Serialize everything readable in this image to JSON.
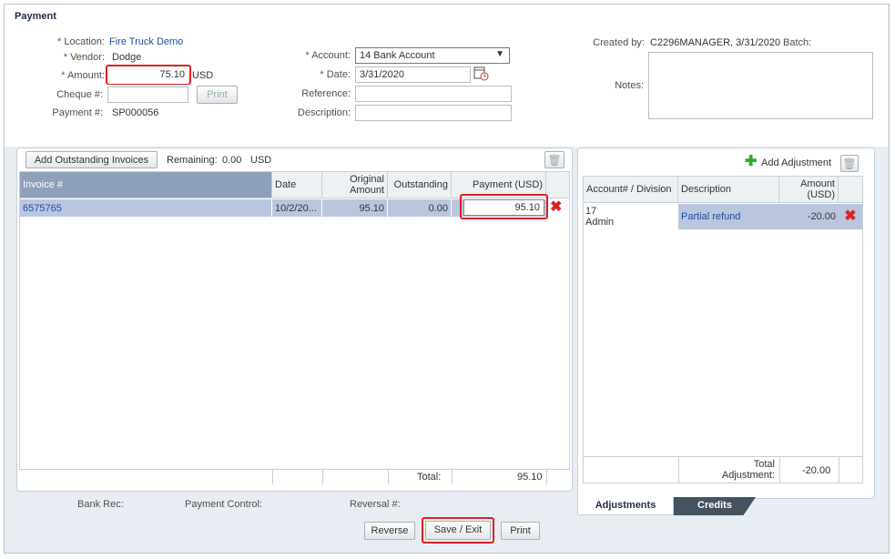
{
  "page": {
    "title": "Payment"
  },
  "form": {
    "location_label": "Location:",
    "location_value": "Fire Truck Demo",
    "vendor_label": "Vendor:",
    "vendor_value": "Dodge",
    "amount_label": "Amount:",
    "amount_value": "75.10",
    "amount_currency": "USD",
    "cheque_label": "Cheque #:",
    "cheque_value": "",
    "print_label": "Print",
    "payment_no_label": "Payment #:",
    "payment_no_value": "SP000056",
    "account_label": "Account:",
    "account_value": "14 Bank Account",
    "date_label": "Date:",
    "date_value": "3/31/2020",
    "reference_label": "Reference:",
    "reference_value": "",
    "description_label": "Description:",
    "description_value": "",
    "created_by_label": "Created by:",
    "created_by_value": "C2296MANAGER, 3/31/2020",
    "batch_label": "Batch:",
    "notes_label": "Notes:",
    "notes_value": ""
  },
  "invoices": {
    "add_button": "Add Outstanding Invoices",
    "remaining_label": "Remaining:",
    "remaining_value": "0.00",
    "remaining_currency": "USD",
    "columns": [
      "Invoice #",
      "Date",
      "Original Amount",
      "Outstanding",
      "Payment (USD)"
    ],
    "rows": [
      {
        "invoice": "6575765",
        "date": "10/2/20...",
        "original": "95.10",
        "outstanding": "0.00",
        "payment": "95.10"
      }
    ],
    "total_label": "Total:",
    "total_value": "95.10"
  },
  "adjustments": {
    "add_button": "Add Adjustment",
    "columns": [
      "Account# / Division",
      "Description",
      "Amount (USD)"
    ],
    "rows": [
      {
        "account": "17",
        "division": "Admin",
        "description": "Partial refund",
        "amount": "-20.00"
      }
    ],
    "total_label": "Total Adjustment:",
    "total_value": "-20.00",
    "tabs": [
      "Adjustments",
      "Credits"
    ]
  },
  "footer": {
    "bank_rec_label": "Bank Rec:",
    "payment_control_label": "Payment Control:",
    "reversal_label": "Reversal #:",
    "reverse_button": "Reverse",
    "save_exit_button": "Save / Exit",
    "print_button": "Print"
  }
}
